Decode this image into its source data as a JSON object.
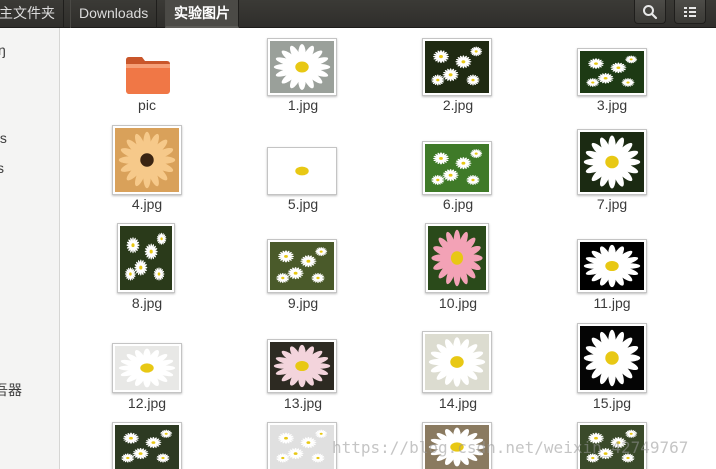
{
  "breadcrumbs": [
    "主文件夹",
    "Downloads",
    "实验图片"
  ],
  "header_buttons": {
    "search": "search-icon",
    "view": "list-view-icon"
  },
  "sidebar": {
    "items": [
      "ŋ",
      "ts",
      "s",
      "吾器"
    ]
  },
  "files": [
    {
      "name": "pic",
      "kind": "folder"
    },
    {
      "name": "1.jpg",
      "kind": "image"
    },
    {
      "name": "2.jpg",
      "kind": "image"
    },
    {
      "name": "3.jpg",
      "kind": "image"
    },
    {
      "name": "4.jpg",
      "kind": "image"
    },
    {
      "name": "5.jpg",
      "kind": "image"
    },
    {
      "name": "6.jpg",
      "kind": "image"
    },
    {
      "name": "7.jpg",
      "kind": "image"
    },
    {
      "name": "8.jpg",
      "kind": "image"
    },
    {
      "name": "9.jpg",
      "kind": "image"
    },
    {
      "name": "10.jpg",
      "kind": "image"
    },
    {
      "name": "11.jpg",
      "kind": "image"
    },
    {
      "name": "12.jpg",
      "kind": "image"
    },
    {
      "name": "13.jpg",
      "kind": "image"
    },
    {
      "name": "14.jpg",
      "kind": "image"
    },
    {
      "name": "15.jpg",
      "kind": "image"
    },
    {
      "name": "",
      "kind": "image"
    },
    {
      "name": "",
      "kind": "image"
    },
    {
      "name": "",
      "kind": "image"
    },
    {
      "name": "",
      "kind": "image"
    }
  ],
  "watermark": "https://blog.csdn.net/weixin_42749767",
  "colors": {
    "header": "#3b3a36",
    "folder": "#f07746",
    "sidebar": "#f4f4f3"
  }
}
